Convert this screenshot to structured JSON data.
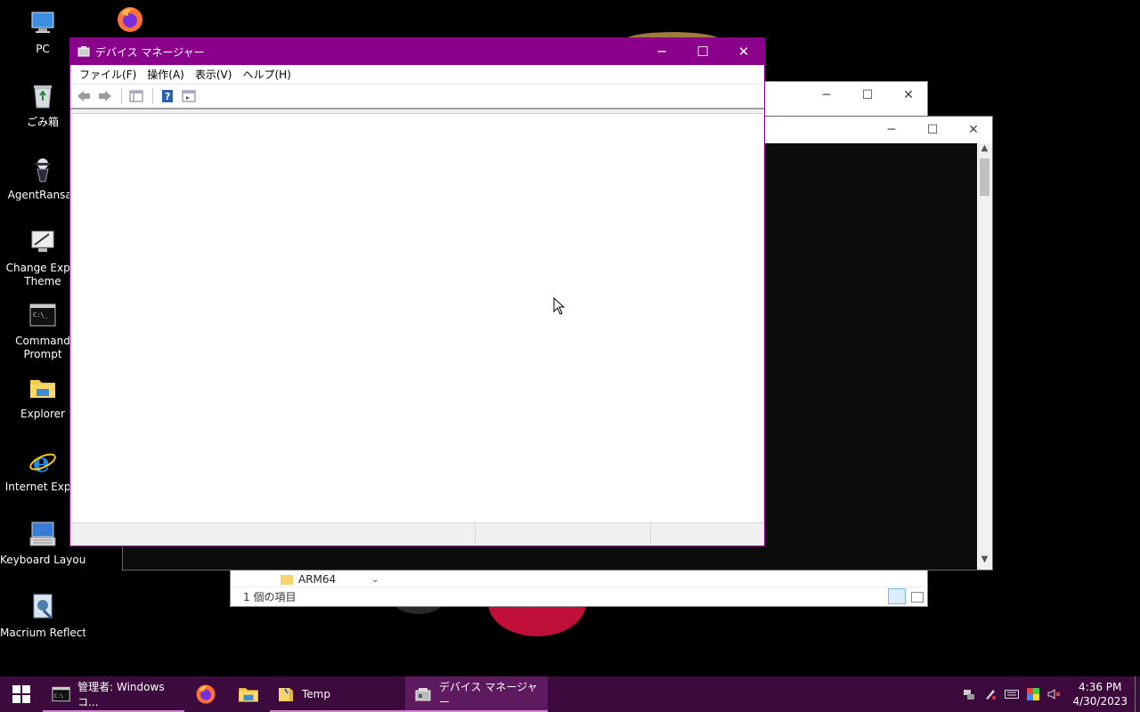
{
  "desktop": {
    "icons": [
      {
        "label": "PC",
        "icon": "pc-icon"
      },
      {
        "label": "ごみ箱",
        "icon": "recycle-bin-icon"
      },
      {
        "label": "AgentRansac",
        "icon": "agent-ransack-icon"
      },
      {
        "label": "Change Explo",
        "label2": "Theme",
        "icon": "change-theme-icon"
      },
      {
        "label": "Command",
        "label2": "Prompt",
        "icon": "command-prompt-icon"
      },
      {
        "label": "Explorer",
        "icon": "folder-icon"
      },
      {
        "label": "Internet Explo",
        "icon": "internet-explorer-icon"
      },
      {
        "label": "Keyboard Layout",
        "icon": "keyboard-layout-icon"
      },
      {
        "label": "Macrium Reflect",
        "icon": "macrium-reflect-icon"
      }
    ]
  },
  "explorer_window": {
    "folder_item": "ARM64",
    "status": "1 個の項目"
  },
  "device_manager": {
    "title": "デバイス マネージャー",
    "menu": [
      "ファイル(F)",
      "操作(A)",
      "表示(V)",
      "ヘルプ(H)"
    ]
  },
  "taskbar": {
    "items": [
      {
        "label": "管理者: Windows コ...",
        "icon": "cmd-icon"
      },
      {
        "label": "",
        "icon": "firefox-icon"
      },
      {
        "label": "",
        "icon": "file-explorer-icon"
      },
      {
        "label": "Temp",
        "icon": "folder-icon"
      },
      {
        "label": "デバイス マネージャー",
        "icon": "device-manager-icon"
      }
    ],
    "time": "4:36 PM",
    "date": "4/30/2023"
  },
  "colors": {
    "accent": "#8b008b",
    "taskbar": "#3d0a3d"
  }
}
